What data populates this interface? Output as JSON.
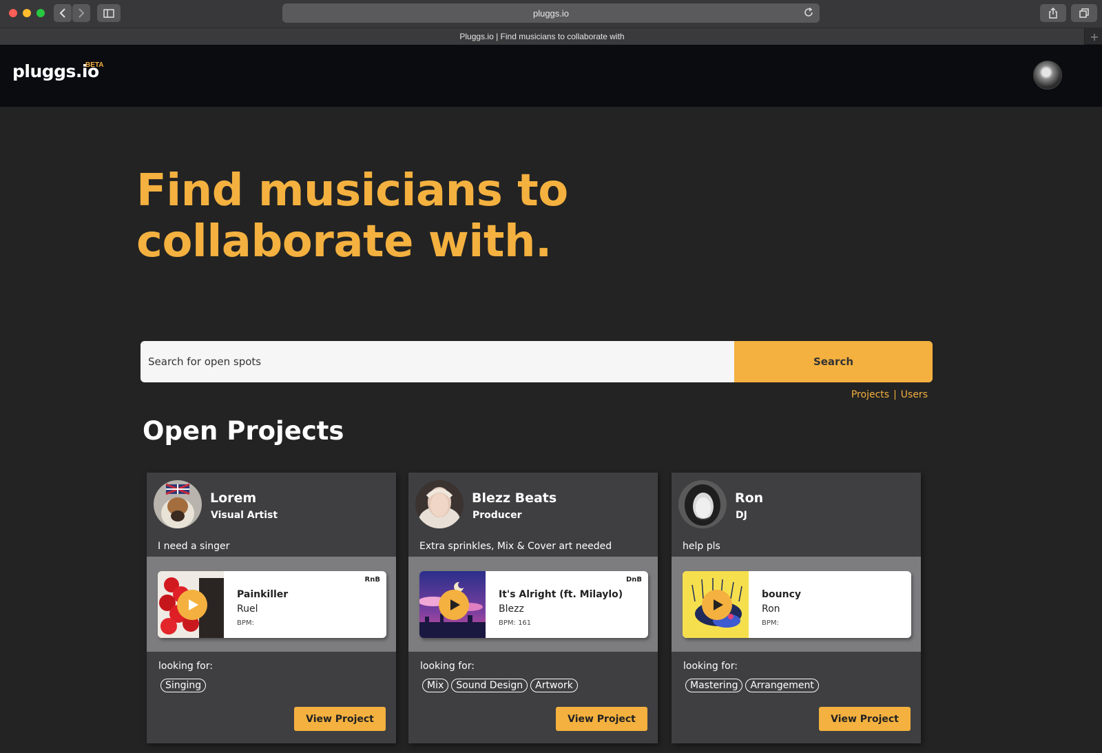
{
  "browser": {
    "url": "pluggs.io",
    "tab_title": "Pluggs.io | Find musicians to collaborate with",
    "new_tab_symbol": "+",
    "icons": [
      "back-icon",
      "forward-icon",
      "sidebar-icon",
      "reload-icon",
      "share-icon",
      "tabs-icon"
    ]
  },
  "header": {
    "logo": "pluggs.io",
    "beta": "BETA"
  },
  "hero": {
    "line1": "Find musicians to",
    "line2": "collaborate with."
  },
  "search": {
    "placeholder": "Search for open spots",
    "button_label": "Search",
    "toggle_projects": "Projects",
    "toggle_separator": "|",
    "toggle_users": "Users"
  },
  "section_title": "Open Projects",
  "cards": [
    {
      "name": "Lorem",
      "role": "Visual Artist",
      "description": "I need a singer",
      "track": {
        "genre": "RnB",
        "title": "Painkiller",
        "artist": "Ruel",
        "bpm": "BPM:"
      },
      "looking_for_label": "looking for:",
      "tags": [
        "Singing"
      ],
      "button_label": "View Project"
    },
    {
      "name": "Blezz Beats",
      "role": "Producer",
      "description": "Extra sprinkles, Mix & Cover art needed",
      "track": {
        "genre": "DnB",
        "title": "It's Alright (ft. Milaylo)",
        "artist": "Blezz",
        "bpm": "BPM: 161"
      },
      "looking_for_label": "looking for:",
      "tags": [
        "Mix",
        "Sound Design",
        "Artwork"
      ],
      "button_label": "View Project"
    },
    {
      "name": "Ron",
      "role": "DJ",
      "description": "help pls",
      "track": {
        "genre": "",
        "title": "bouncy",
        "artist": "Ron",
        "bpm": "BPM:"
      },
      "looking_for_label": "looking for:",
      "tags": [
        "Mastering",
        "Arrangement"
      ],
      "button_label": "View Project"
    }
  ],
  "colors": {
    "accent": "#f4b13f",
    "background": "#232323",
    "card": "#3f3f41",
    "track_area": "#7d7d80"
  }
}
